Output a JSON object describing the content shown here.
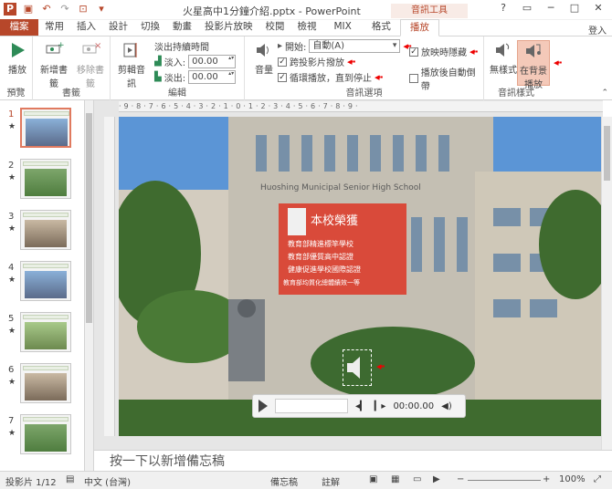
{
  "window": {
    "title": "火星高中1分鐘介紹.pptx - PowerPoint",
    "tool_group": "音訊工具",
    "login": "登入"
  },
  "tabs": [
    "檔案",
    "常用",
    "插入",
    "設計",
    "切換",
    "動畫",
    "投影片放映",
    "校閱",
    "檢視",
    "MIX",
    "格式",
    "播放"
  ],
  "active_tab": "播放",
  "ribbon": {
    "preview": {
      "label": "預覽",
      "play": "播放"
    },
    "bookmark": {
      "label": "書籤",
      "add": "新增書籤",
      "remove": "移除書籤"
    },
    "edit": {
      "label": "編輯",
      "trim": "剪輯音訊",
      "fade_title": "淡出持續時間",
      "fade_in_label": "淡入:",
      "fade_in_value": "00.00",
      "fade_out_label": "淡出:",
      "fade_out_value": "00.00"
    },
    "audio_options": {
      "label": "音訊選項",
      "volume": "音量",
      "start_label": "開始:",
      "start_value": "自動(A)",
      "cross_slides": "跨投影片撥放",
      "loop": "循環播放，直到停止",
      "hide": "放映時隱藏",
      "rewind": "播放後自動倒帶"
    },
    "audio_style": {
      "label": "音訊樣式",
      "no_style": "無樣式",
      "bg_play": "在背景播放"
    }
  },
  "slides": [
    {
      "num": "1"
    },
    {
      "num": "2"
    },
    {
      "num": "3"
    },
    {
      "num": "4"
    },
    {
      "num": "5"
    },
    {
      "num": "6"
    },
    {
      "num": "7"
    }
  ],
  "slide_banner": {
    "title": "本校榮獲",
    "lines": [
      "教育部精進標竿學校",
      "教育部優質高中認證",
      "健康促進學校國際認證",
      "教育部均質化總體績效一等"
    ]
  },
  "building_sign": "Huoshing Municipal Senior High School",
  "media": {
    "time": "00:00.00"
  },
  "notes_placeholder": "按一下以新增備忘稿",
  "status": {
    "slide": "投影片 1/12",
    "lang": "中文 (台灣)",
    "notes": "備忘稿",
    "comments": "註解",
    "zoom": "100%"
  },
  "colors": {
    "accent": "#b7472a",
    "arrow": "#ee0000"
  }
}
